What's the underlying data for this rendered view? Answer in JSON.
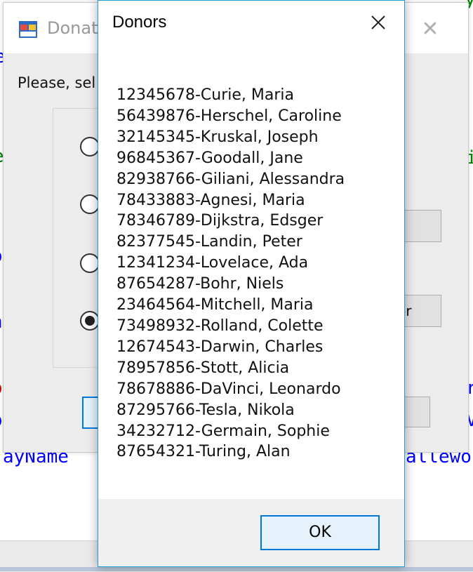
{
  "background_ide": {
    "fragment_name_bottom_left": "ayName",
    "fragment_name_bottom_right": "allewo",
    "left_edge_fragments": [
      "e",
      "e",
      "o",
      "n",
      "o",
      "o"
    ],
    "right_edge_fragments": [
      "y",
      "i",
      "r",
      "V"
    ]
  },
  "main_form": {
    "title": "Donat",
    "prompt": "Please, sel",
    "button_1_label": "r",
    "button_2_label": "or",
    "radio_checked_index": 3
  },
  "dialog": {
    "title": "Donors",
    "close_icon": "close-icon",
    "donors": [
      "12345678-Curie, Maria",
      "56439876-Herschel, Caroline",
      "32145345-Kruskal, Joseph",
      "96845367-Goodall, Jane",
      "82938766-Giliani, Alessandra",
      "78433883-Agnesi, Maria",
      "78346789-Dijkstra, Edsger",
      "82377545-Landin, Peter",
      "12341234-Lovelace, Ada",
      "87654287-Bohr, Niels",
      "23464564-Mitchell, Maria",
      "73498932-Rolland, Colette",
      "12674543-Darwin, Charles",
      "78957856-Stott, Alicia",
      "78678886-DaVinci, Leonardo",
      "87295766-Tesla, Nikola",
      "34232712-Germain, Sophie",
      "87654321-Turing, Alan"
    ],
    "ok_label": "OK"
  },
  "colors": {
    "accent_blue": "#0078d7",
    "dialog_border": "#1f9ed8",
    "ide_blue": "#0000ff",
    "ide_green": "#008000",
    "ide_red": "#d00000"
  }
}
